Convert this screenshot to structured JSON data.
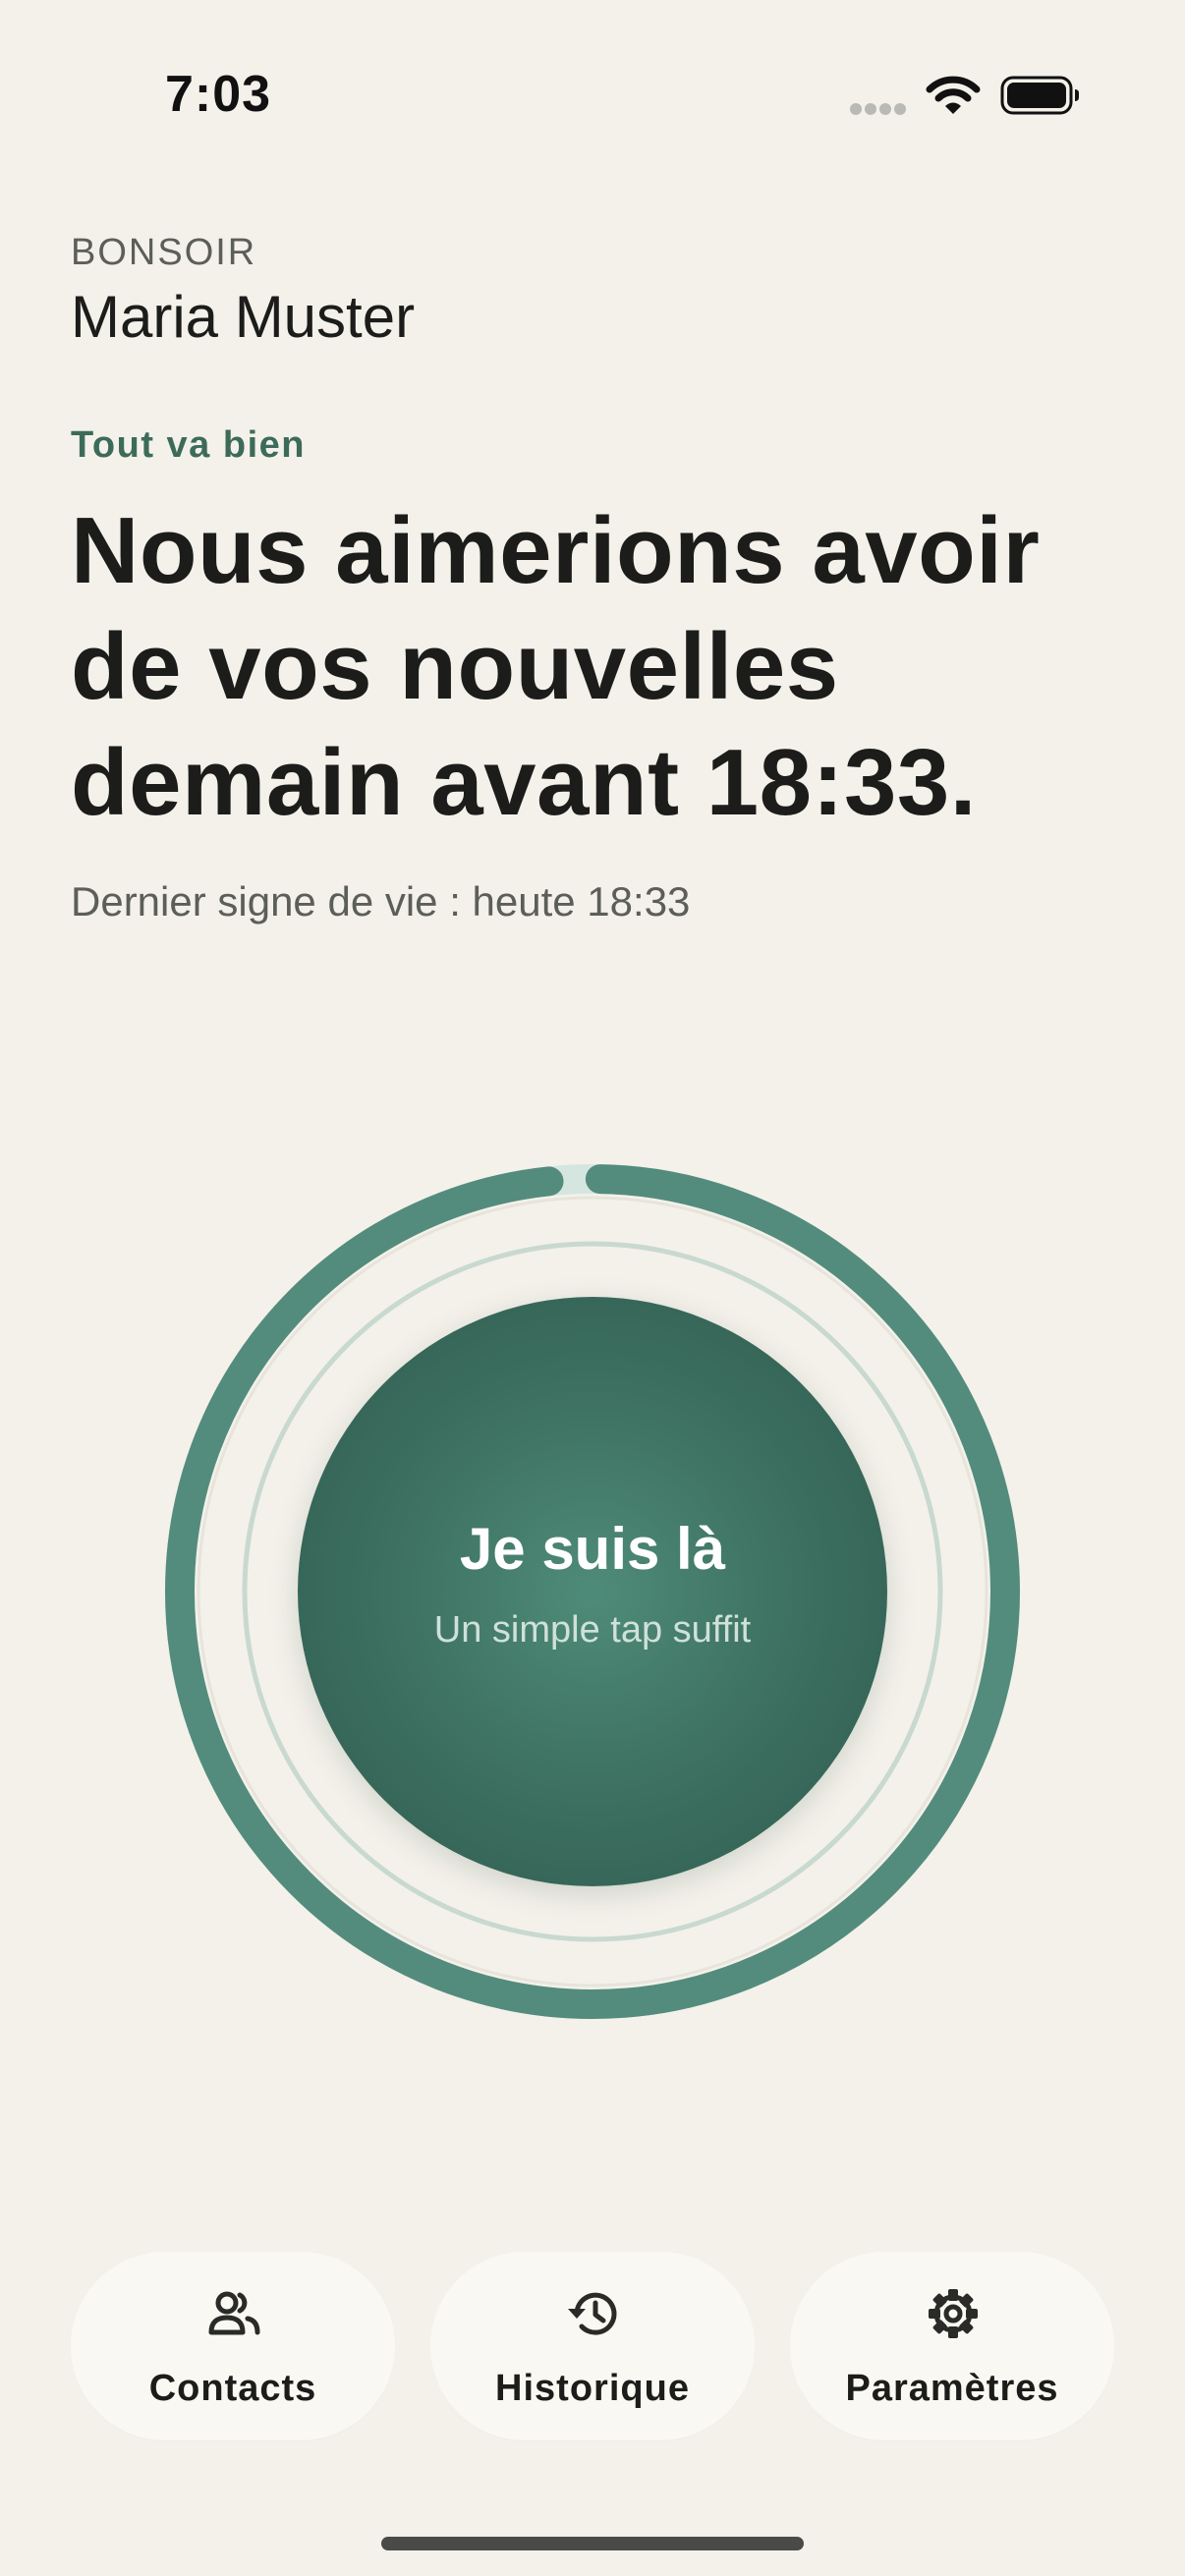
{
  "status_bar": {
    "time": "7:03",
    "signal_icon": "cellular-signal-icon",
    "wifi_icon": "wifi-icon",
    "battery_icon": "battery-icon"
  },
  "header": {
    "greeting": "BONSOIR",
    "user_name": "Maria Muster"
  },
  "status": {
    "label": "Tout va bien",
    "headline_lines": [
      "Nous aimerions avoir",
      "de vos nouvelles",
      "demain avant 18:33."
    ],
    "last_sign": "Dernier signe de vie : heute 18:33"
  },
  "checkin": {
    "title": "Je suis là",
    "subtitle": "Un simple tap suffit",
    "progress_fraction": 0.98,
    "colors": {
      "progress": "#538c7c",
      "track": "#d5e6e1",
      "inner_ring": "#c8d9cf",
      "button": "#3e7262"
    }
  },
  "nav": {
    "items": [
      {
        "label": "Contacts",
        "icon": "contacts-icon"
      },
      {
        "label": "Historique",
        "icon": "history-icon"
      },
      {
        "label": "Paramètres",
        "icon": "gear-icon"
      }
    ]
  },
  "colors": {
    "background": "#f4f1ea",
    "accent": "#3d6b5a",
    "text": "#1c1d1a",
    "muted": "#5c5e58"
  }
}
